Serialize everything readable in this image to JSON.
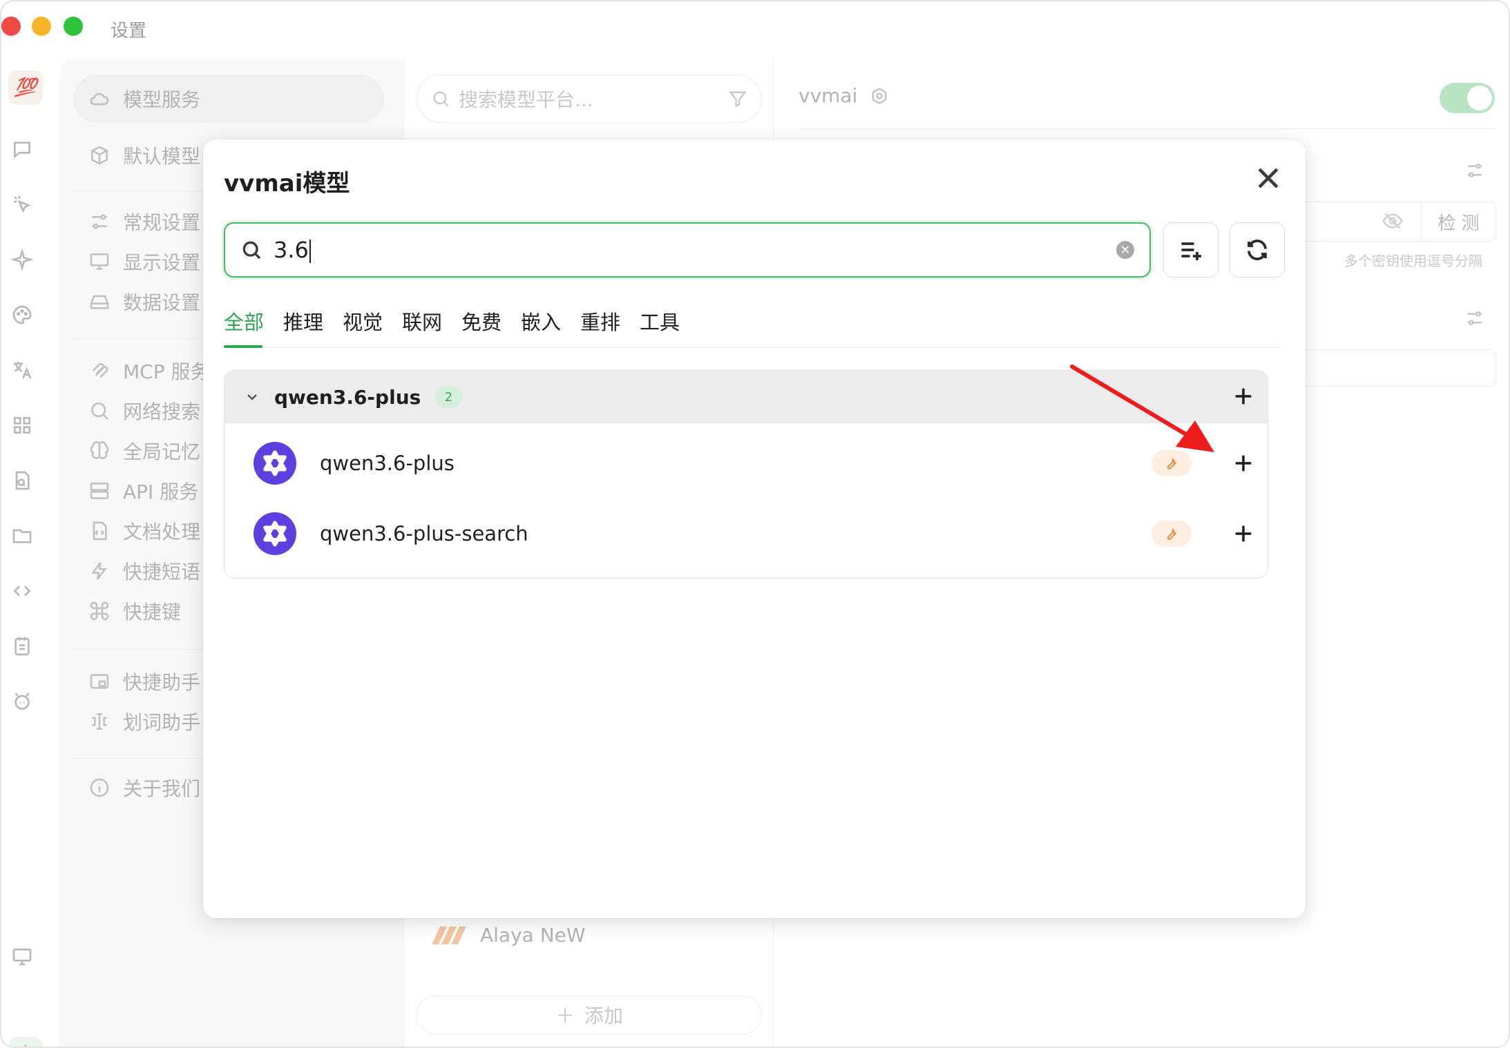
{
  "window": {
    "title": "设置"
  },
  "iconbar": {
    "avatar": "💯",
    "items": [
      "chat-icon",
      "cursor-icon",
      "sparkle-icon",
      "palette-icon",
      "translate-icon",
      "apps-icon",
      "document-search-icon",
      "folder-icon",
      "code-icon",
      "notes-icon",
      "bot-icon",
      "monitor-icon",
      "settings-icon"
    ]
  },
  "menu": {
    "items": [
      {
        "label": "模型服务",
        "icon": "cloud-icon"
      },
      {
        "label": "默认模型",
        "icon": "cube-icon"
      },
      {
        "label": "常规设置",
        "icon": "sliders-icon"
      },
      {
        "label": "显示设置",
        "icon": "display-icon"
      },
      {
        "label": "数据设置",
        "icon": "storage-icon"
      },
      {
        "label": "MCP 服务",
        "icon": "mcp-icon"
      },
      {
        "label": "网络搜索",
        "icon": "search-icon"
      },
      {
        "label": "全局记忆",
        "icon": "brain-icon"
      },
      {
        "label": "API 服务",
        "icon": "server-icon"
      },
      {
        "label": "文档处理",
        "icon": "file-code-icon"
      },
      {
        "label": "快捷短语",
        "icon": "zap-icon"
      },
      {
        "label": "快捷键",
        "icon": "command-icon"
      },
      {
        "label": "快捷助手",
        "icon": "assistant-icon"
      },
      {
        "label": "划词助手",
        "icon": "text-cursor-icon"
      },
      {
        "label": "关于我们",
        "icon": "info-icon"
      }
    ]
  },
  "providers": {
    "search_placeholder": "搜索模型平台...",
    "visible_item": "Alaya NeW",
    "add_label": "添加"
  },
  "detail": {
    "provider_name": "vvmai",
    "check_label": "检 测",
    "key_hint": "多个密钥使用逗号分隔"
  },
  "modal": {
    "title": "vvmai模型",
    "search_value": "3.6",
    "tabs": [
      "全部",
      "推理",
      "视觉",
      "联网",
      "免费",
      "嵌入",
      "重排",
      "工具"
    ],
    "active_tab": "全部",
    "group": {
      "name": "qwen3.6-plus",
      "count": "2",
      "models": [
        {
          "name": "qwen3.6-plus",
          "capability": "tool-icon"
        },
        {
          "name": "qwen3.6-plus-search",
          "capability": "tool-icon"
        }
      ]
    }
  },
  "colors": {
    "accent": "#2fa552",
    "model_logo": "#5e3fe0",
    "tool_badge_bg": "#fdeee1",
    "annotation_arrow": "#ee1c1c"
  }
}
